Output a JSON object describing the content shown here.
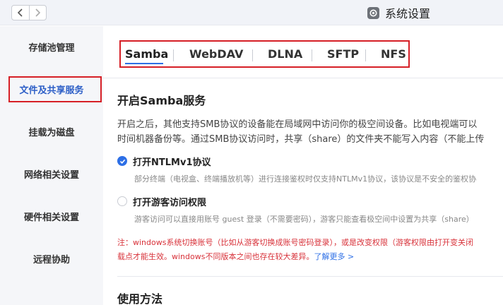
{
  "window": {
    "title": "系统设置"
  },
  "sidebar": {
    "items": [
      {
        "label": "存储池管理"
      },
      {
        "label": "文件及共享服务"
      },
      {
        "label": "挂载为磁盘"
      },
      {
        "label": "网络相关设置"
      },
      {
        "label": "硬件相关设置"
      },
      {
        "label": "远程协助"
      }
    ]
  },
  "tabs": [
    {
      "label": "Samba"
    },
    {
      "label": "WebDAV"
    },
    {
      "label": "DLNA"
    },
    {
      "label": "SFTP"
    },
    {
      "label": "NFS"
    }
  ],
  "samba": {
    "title": "开启Samba服务",
    "desc_line1": "开启之后，其他支持SMB协议的设备能在局域网中访问你的极空间设备。比如电视端可以",
    "desc_line2": "时间机器备份等。通过SMB协议访问时，共享（share）的文件夹不能写入内容（不能上传",
    "options": [
      {
        "label": "打开NTLMv1协议",
        "checked": true,
        "desc": "部分终端（电视盒、终端播放机等）进行连接鉴权时仅支持NTLMv1协议，该协议是不安全的鉴权协"
      },
      {
        "label": "打开游客访问权限",
        "checked": false,
        "desc": "游客访问可以直接用账号 guest 登录（不需要密码），游客只能查看极空间中设置为共享（share）"
      }
    ],
    "note_line1": "注：windows系统切换账号（比如从游客切换成账号密码登录），或是改变权限（游客权限由打开变关闭",
    "note_line2": "载点才能生效。windows不同版本之间也存在较大差异。",
    "note_link": "了解更多 >"
  },
  "usage": {
    "title": "使用方法"
  },
  "colors": {
    "accent": "#2d6fe6",
    "highlight": "#d61f26",
    "note": "#d8323a"
  },
  "icons": [
    "chevron-left-icon",
    "chevron-right-icon",
    "settings-app-icon",
    "checkmark-icon"
  ]
}
